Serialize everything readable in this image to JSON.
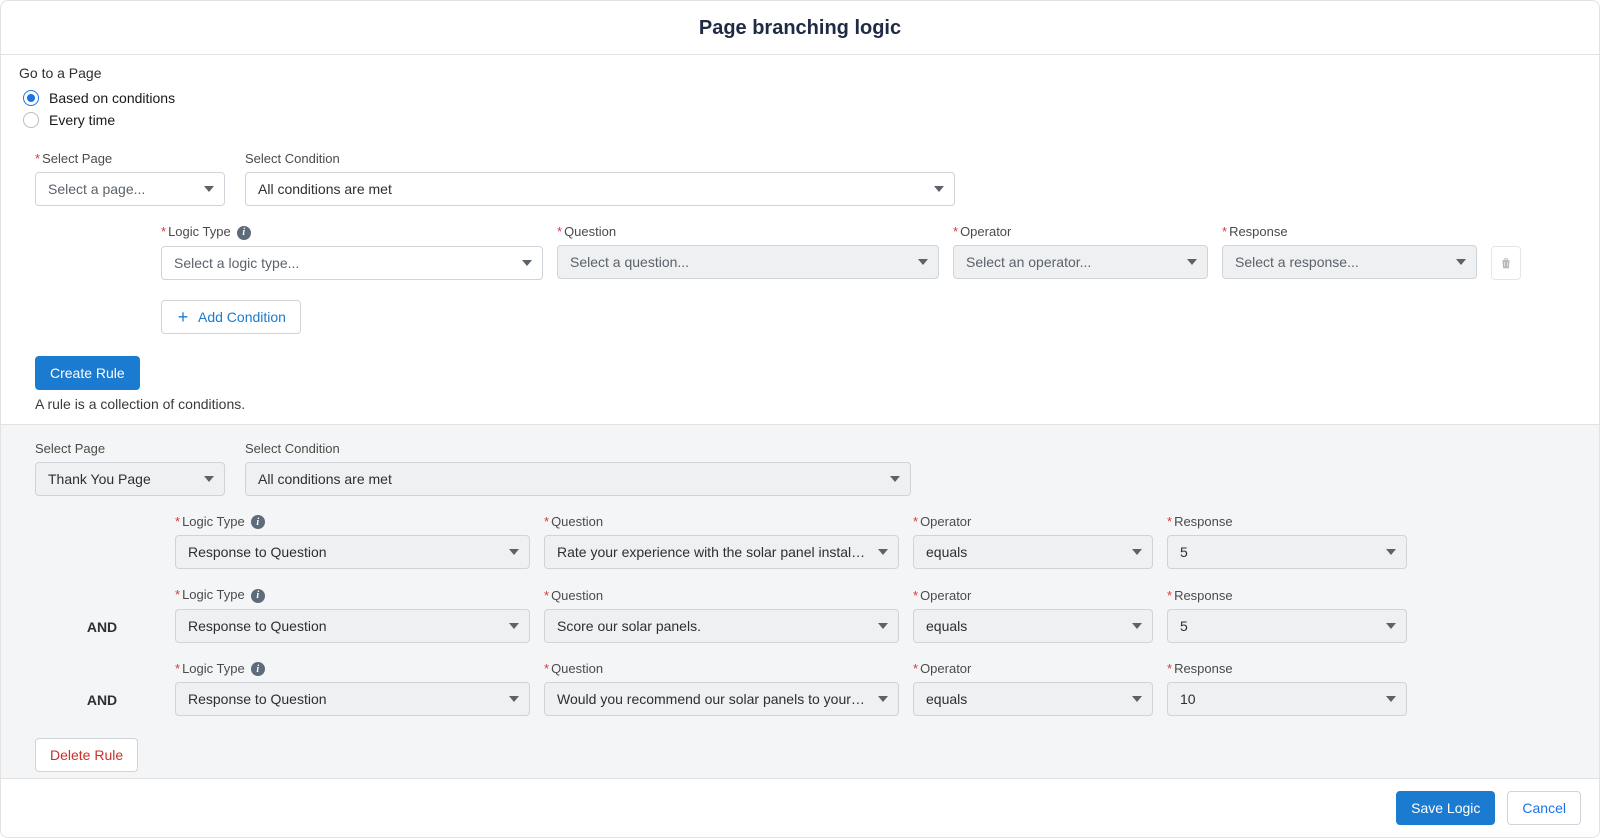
{
  "header": {
    "title": "Page branching logic"
  },
  "goTo": {
    "title": "Go to a Page",
    "options": {
      "conditions": "Based on conditions",
      "everytime": "Every time"
    }
  },
  "upper": {
    "selectPage": {
      "label": "Select Page",
      "placeholder": "Select a page..."
    },
    "selectCondition": {
      "label": "Select Condition",
      "value": "All conditions are met"
    },
    "logicType": {
      "label": "Logic Type",
      "placeholder": "Select a logic type..."
    },
    "question": {
      "label": "Question",
      "placeholder": "Select a question..."
    },
    "operator": {
      "label": "Operator",
      "placeholder": "Select an operator..."
    },
    "response": {
      "label": "Response",
      "placeholder": "Select a response..."
    },
    "addCondition": "Add Condition",
    "createRule": "Create Rule",
    "hint": "A rule is a collection of conditions."
  },
  "saved": {
    "selectPage": {
      "label": "Select Page",
      "value": "Thank You Page"
    },
    "selectCondition": {
      "label": "Select Condition",
      "value": "All conditions are met"
    },
    "and": "AND",
    "labels": {
      "logicType": "Logic Type",
      "question": "Question",
      "operator": "Operator",
      "response": "Response"
    },
    "rows": [
      {
        "logicType": "Response to Question",
        "question": "Rate your experience with the solar panel installation",
        "operator": "equals",
        "response": "5"
      },
      {
        "logicType": "Response to Question",
        "question": "Score our solar panels.",
        "operator": "equals",
        "response": "5"
      },
      {
        "logicType": "Response to Question",
        "question": "Would you recommend our solar panels to your friends",
        "operator": "equals",
        "response": "10"
      }
    ],
    "deleteRule": "Delete Rule"
  },
  "footer": {
    "save": "Save Logic",
    "cancel": "Cancel"
  }
}
